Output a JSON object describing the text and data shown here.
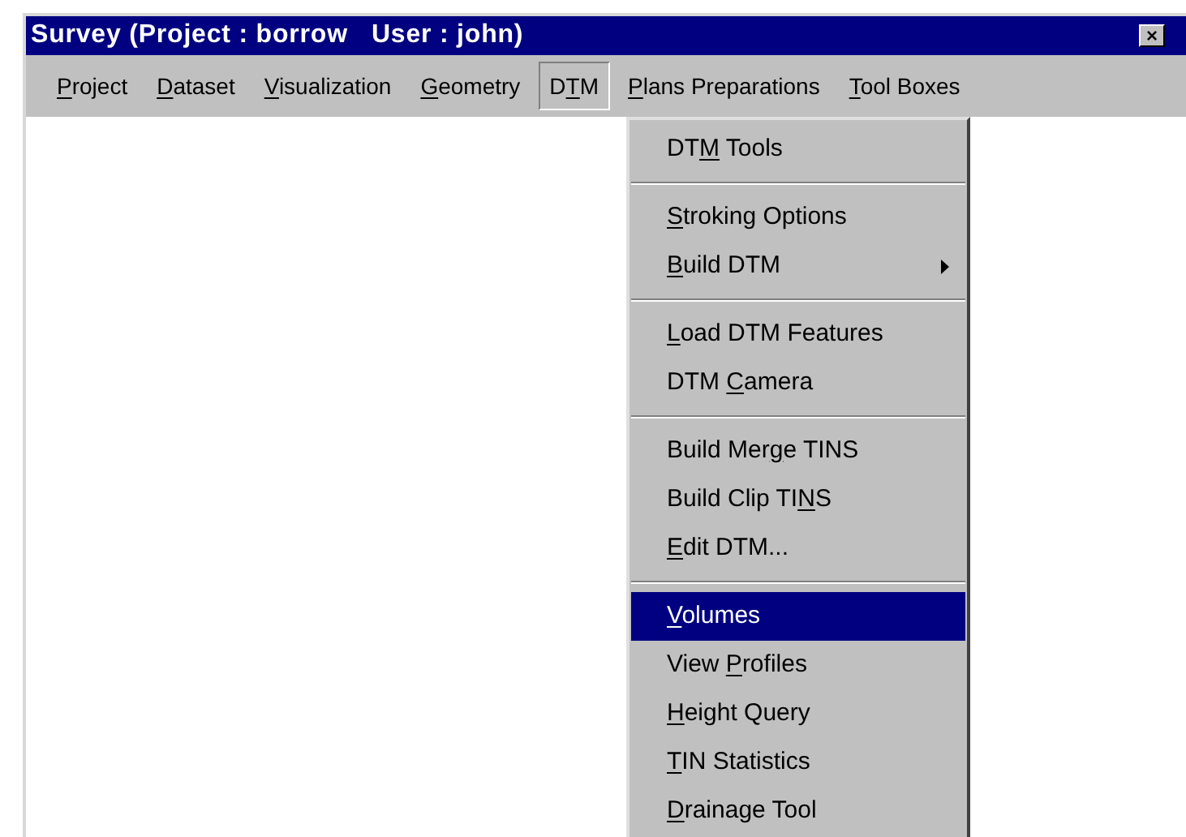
{
  "window": {
    "title": "Survey (Project : borrow   User : john)",
    "close": "×"
  },
  "menu_bar": [
    {
      "label": {
        "key": "P",
        "after": "roject"
      },
      "selected": false
    },
    {
      "label": {
        "key": "D",
        "after": "ataset"
      },
      "selected": false
    },
    {
      "label": {
        "key": "V",
        "after": "isualization"
      },
      "selected": false
    },
    {
      "label": {
        "key": "G",
        "after": "eometry"
      },
      "selected": false
    },
    {
      "label": {
        "before": "D",
        "key": "T",
        "after": "M"
      },
      "selected": true
    },
    {
      "label": {
        "key": "P",
        "after": "lans Preparations"
      },
      "selected": false
    },
    {
      "label": {
        "key": "T",
        "after": "ool Boxes"
      },
      "selected": false
    }
  ],
  "dropdown": {
    "groups": [
      [
        {
          "label": {
            "before": "DT",
            "key": "M",
            "after": " Tools"
          },
          "selected": false,
          "submenu": false
        }
      ],
      [
        {
          "label": {
            "key": "S",
            "after": "troking Options"
          },
          "selected": false,
          "submenu": false
        },
        {
          "label": {
            "key": "B",
            "after": "uild DTM"
          },
          "selected": false,
          "submenu": true
        }
      ],
      [
        {
          "label": {
            "key": "L",
            "after": "oad DTM Features"
          },
          "selected": false,
          "submenu": false
        },
        {
          "label": {
            "before": "DTM ",
            "key": "C",
            "after": "amera"
          },
          "selected": false,
          "submenu": false
        }
      ],
      [
        {
          "label": {
            "before": "Build Mer",
            "key": "g",
            "after": "e TINS"
          },
          "selected": false,
          "submenu": false
        },
        {
          "label": {
            "before": "Build Clip TI",
            "key": "N",
            "after": "S"
          },
          "selected": false,
          "submenu": false
        },
        {
          "label": {
            "key": "E",
            "after": "dit DTM..."
          },
          "selected": false,
          "submenu": false
        }
      ],
      [
        {
          "label": {
            "key": "V",
            "after": "olumes"
          },
          "selected": true,
          "submenu": false
        },
        {
          "label": {
            "before": "View ",
            "key": "P",
            "after": "rofiles"
          },
          "selected": false,
          "submenu": false
        },
        {
          "label": {
            "key": "H",
            "after": "eight Query"
          },
          "selected": false,
          "submenu": false
        },
        {
          "label": {
            "key": "T",
            "after": "IN Statistics"
          },
          "selected": false,
          "submenu": false
        },
        {
          "label": {
            "key": "D",
            "after": "rainage Tool"
          },
          "selected": false,
          "submenu": false
        }
      ]
    ]
  }
}
